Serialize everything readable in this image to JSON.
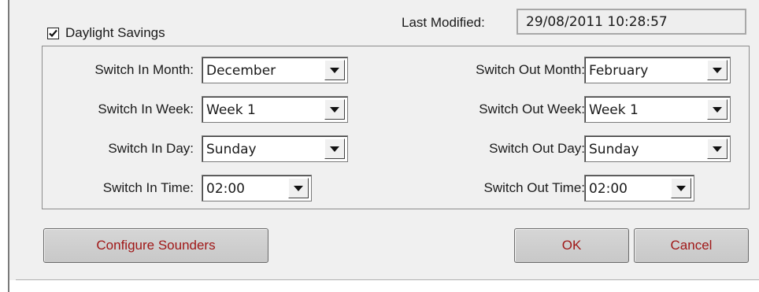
{
  "daylight_savings": {
    "label": "Daylight Savings",
    "checked": true
  },
  "last_modified": {
    "label": "Last Modified:",
    "value": "29/08/2011 10:28:57"
  },
  "switch_in": {
    "month": {
      "label": "Switch In Month:",
      "value": "December"
    },
    "week": {
      "label": "Switch In Week:",
      "value": "Week 1"
    },
    "day": {
      "label": "Switch In Day:",
      "value": "Sunday"
    },
    "time": {
      "label": "Switch In Time:",
      "value": "02:00"
    }
  },
  "switch_out": {
    "month": {
      "label": "Switch Out Month:",
      "value": "February"
    },
    "week": {
      "label": "Switch Out Week:",
      "value": "Week 1"
    },
    "day": {
      "label": "Switch Out Day:",
      "value": "Sunday"
    },
    "time": {
      "label": "Switch Out Time:",
      "value": "02:00"
    }
  },
  "buttons": {
    "configure_sounders": "Configure Sounders",
    "ok": "OK",
    "cancel": "Cancel"
  },
  "colors": {
    "button_text": "#a01818",
    "dialog_background": "#f0f0f0"
  }
}
